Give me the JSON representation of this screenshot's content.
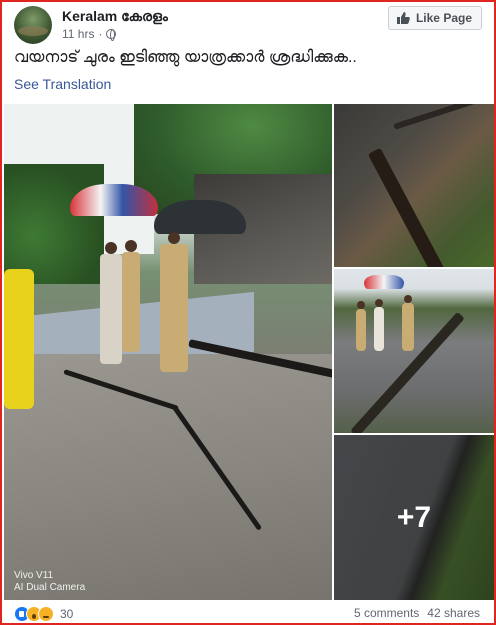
{
  "post": {
    "page_name": "Keralam കേരളം",
    "time": "11 hrs",
    "separator": "·",
    "like_page_label": "Like Page",
    "caption": "വയനാട് ചുരം ഇടിഞ്ഞു യാത്രക്കാർ ശ്രദ്ധിക്കുക..",
    "see_translation": "See Translation"
  },
  "photos": {
    "watermark_line1": "Vivo V11",
    "watermark_line2": "AI Dual Camera",
    "more_count": "+7"
  },
  "footer": {
    "reaction_icons": [
      "like-icon",
      "wow-icon",
      "sad-icon"
    ],
    "reaction_count": "30",
    "comments": "5 comments",
    "shares": "42 shares"
  },
  "colors": {
    "border": "#e0241f",
    "link": "#385898",
    "like_reaction": "#1877f2",
    "emoji_reaction": "#f7b125"
  }
}
